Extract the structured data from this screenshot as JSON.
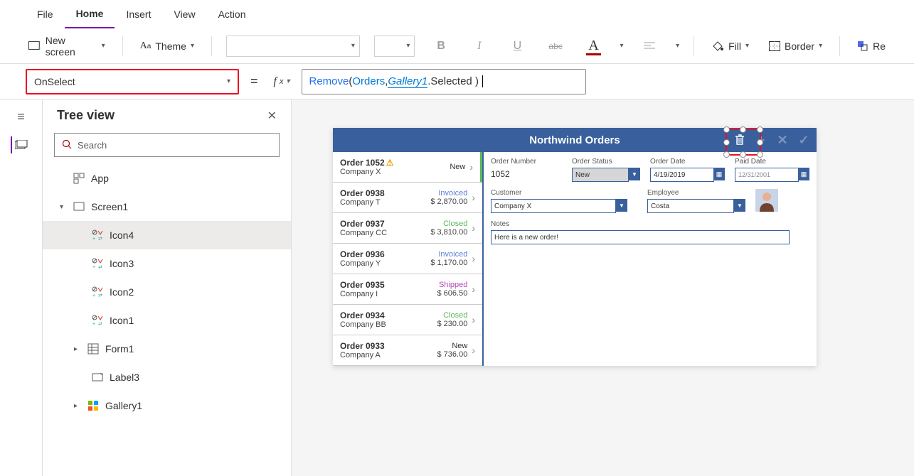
{
  "menubar": {
    "items": [
      "File",
      "Home",
      "Insert",
      "View",
      "Action"
    ],
    "active": "Home"
  },
  "ribbon": {
    "new_screen": "New screen",
    "theme": "Theme",
    "fill": "Fill",
    "border": "Border",
    "re": "Re"
  },
  "formula": {
    "property": "OnSelect",
    "parts": {
      "fn": "Remove",
      "open": "( ",
      "arg1": "Orders",
      "comma": ", ",
      "gal": "Gallery1",
      "sel": ".Selected )"
    }
  },
  "tree": {
    "title": "Tree view",
    "search_placeholder": "Search",
    "app": "App",
    "screen": "Screen1",
    "items": [
      {
        "label": "Icon4",
        "type": "icon",
        "sel": true
      },
      {
        "label": "Icon3",
        "type": "icon"
      },
      {
        "label": "Icon2",
        "type": "icon"
      },
      {
        "label": "Icon1",
        "type": "icon"
      },
      {
        "label": "Form1",
        "type": "form",
        "expandable": true
      },
      {
        "label": "Label3",
        "type": "label"
      },
      {
        "label": "Gallery1",
        "type": "gallery",
        "expandable": true
      }
    ]
  },
  "app": {
    "title": "Northwind Orders",
    "gallery": [
      {
        "order": "Order 1052",
        "warn": true,
        "company": "Company X",
        "status": "New",
        "status_cls": "st-new",
        "amount": "",
        "sel": true
      },
      {
        "order": "Order 0938",
        "company": "Company T",
        "status": "Invoiced",
        "status_cls": "st-invoiced",
        "amount": "$ 2,870.00"
      },
      {
        "order": "Order 0937",
        "company": "Company CC",
        "status": "Closed",
        "status_cls": "st-closed",
        "amount": "$ 3,810.00"
      },
      {
        "order": "Order 0936",
        "company": "Company Y",
        "status": "Invoiced",
        "status_cls": "st-invoiced",
        "amount": "$ 1,170.00"
      },
      {
        "order": "Order 0935",
        "company": "Company I",
        "status": "Shipped",
        "status_cls": "st-shipped",
        "amount": "$ 606.50"
      },
      {
        "order": "Order 0934",
        "company": "Company BB",
        "status": "Closed",
        "status_cls": "st-closed",
        "amount": "$ 230.00"
      },
      {
        "order": "Order 0933",
        "company": "Company A",
        "status": "New",
        "status_cls": "st-new",
        "amount": "$ 736.00"
      }
    ],
    "detail": {
      "labels": {
        "order_number": "Order Number",
        "order_status": "Order Status",
        "order_date": "Order Date",
        "paid_date": "Paid Date",
        "customer": "Customer",
        "employee": "Employee",
        "notes": "Notes"
      },
      "order_number": "1052",
      "order_status": "New",
      "order_date": "4/19/2019",
      "paid_date": "12/31/2001",
      "customer": "Company X",
      "employee": "Costa",
      "notes": "Here is a new order!"
    }
  }
}
